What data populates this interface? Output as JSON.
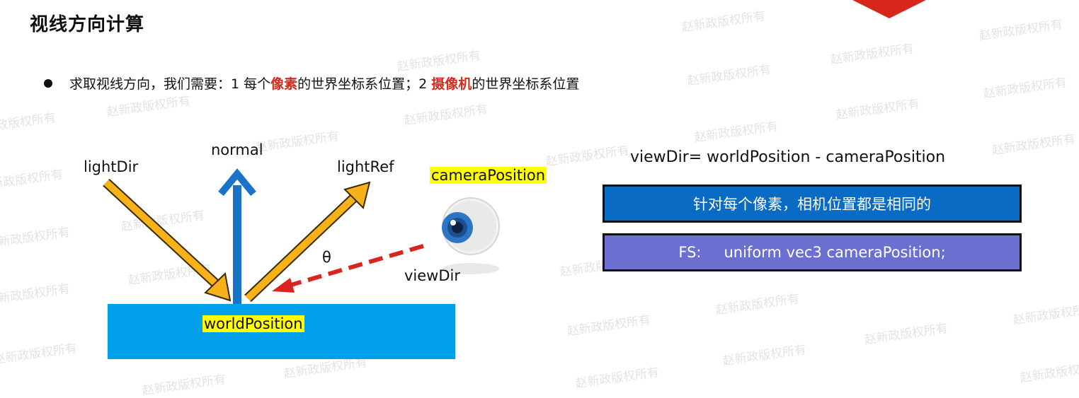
{
  "slide": {
    "title": "视线方向计算",
    "bullet": {
      "text_before": "求取视线方向，我们需要：1 每个",
      "highlight1": "像素",
      "text_middle": "的世界坐标系位置；2 ",
      "highlight2": "摄像机",
      "text_after": "的世界坐标系位置"
    }
  },
  "diagram": {
    "light_dir": "lightDir",
    "normal": "normal",
    "light_ref": "lightRef",
    "camera_position": "cameraPosition",
    "theta": "θ",
    "view_dir": "viewDir",
    "world_position": "worldPosition"
  },
  "right_panel": {
    "formula": "viewDir= worldPosition - cameraPosition",
    "box1_text": "针对每个像素，相机位置都是相同的",
    "box2_label": "FS:",
    "box2_code": "uniform vec3 cameraPosition;"
  },
  "watermark": "赵新政版权所有",
  "colors": {
    "highlight_red": "#d42b1e",
    "arrow_orange": "#f7b21a",
    "normal_blue": "#1873c9",
    "surface_blue": "#00a0ea",
    "label_yellow": "#ffff00",
    "box1_blue": "#0a6bc4",
    "box2_purple": "#6b6fd0",
    "view_dir_red": "#d9251d",
    "corner_red": "#d7261c"
  }
}
